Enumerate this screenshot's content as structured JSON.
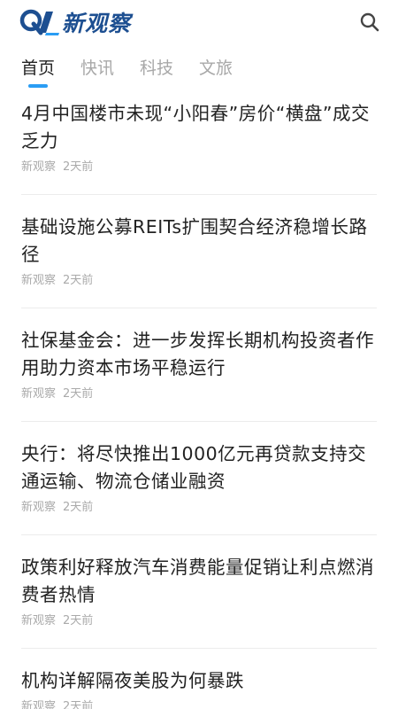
{
  "header": {
    "logo_text": "新观察",
    "brand_color": "#1d4f91",
    "search_icon": "search-icon"
  },
  "tabs": [
    {
      "label": "首页",
      "active": true
    },
    {
      "label": "快讯",
      "active": false
    },
    {
      "label": "科技",
      "active": false
    },
    {
      "label": "文旅",
      "active": false
    }
  ],
  "accent_color": "#2a9df4",
  "articles": [
    {
      "title": "4月中国楼市未现“小阳春”房价“横盘”成交乏力",
      "source": "新观察",
      "time": "2天前"
    },
    {
      "title": "基础设施公募REITs扩围契合经济稳增长路径",
      "source": "新观察",
      "time": "2天前"
    },
    {
      "title": "社保基金会：进一步发挥长期机构投资者作用助力资本市场平稳运行",
      "source": "新观察",
      "time": "2天前"
    },
    {
      "title": "央行：将尽快推出1000亿元再贷款支持交通运输、物流仓储业融资",
      "source": "新观察",
      "time": "2天前"
    },
    {
      "title": "政策利好释放汽车消费能量促销让利点燃消费者热情",
      "source": "新观察",
      "time": "2天前"
    },
    {
      "title": "机构详解隔夜美股为何暴跌",
      "source": "新观察",
      "time": "2天前"
    }
  ]
}
